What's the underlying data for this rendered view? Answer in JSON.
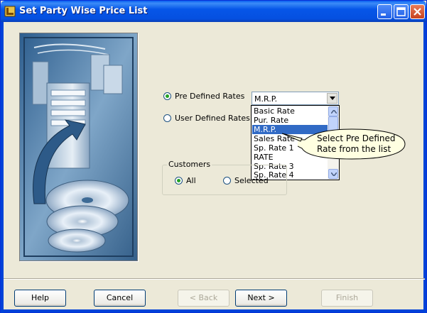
{
  "window": {
    "title": "Set Party Wise Price List",
    "icon": "app-icon",
    "controls": [
      "minimize-icon",
      "maximize-icon",
      "close-icon"
    ]
  },
  "rates": {
    "predefined_label": "Pre Defined Rates",
    "predefined_checked": true,
    "userdefined_label": "User Defined Rates",
    "userdefined_checked": false,
    "combo_value": "M.R.P.",
    "options": [
      "Basic Rate",
      "Pur. Rate",
      "M.R.P.",
      "Sales Rate",
      "Sp. Rate 1",
      "RATE",
      "Sp. Rate 3",
      "Sp. Rate 4"
    ],
    "selected_option": "M.R.P."
  },
  "callout": {
    "line1": "Select Pre Defined",
    "line2": "Rate from the list"
  },
  "customers": {
    "title": "Customers",
    "all_label": "All",
    "all_checked": true,
    "selected_label": "Selected",
    "selected_checked": false
  },
  "buttons": {
    "help": "Help",
    "cancel": "Cancel",
    "back": "< Back",
    "next": "Next >",
    "finish": "Finish"
  }
}
